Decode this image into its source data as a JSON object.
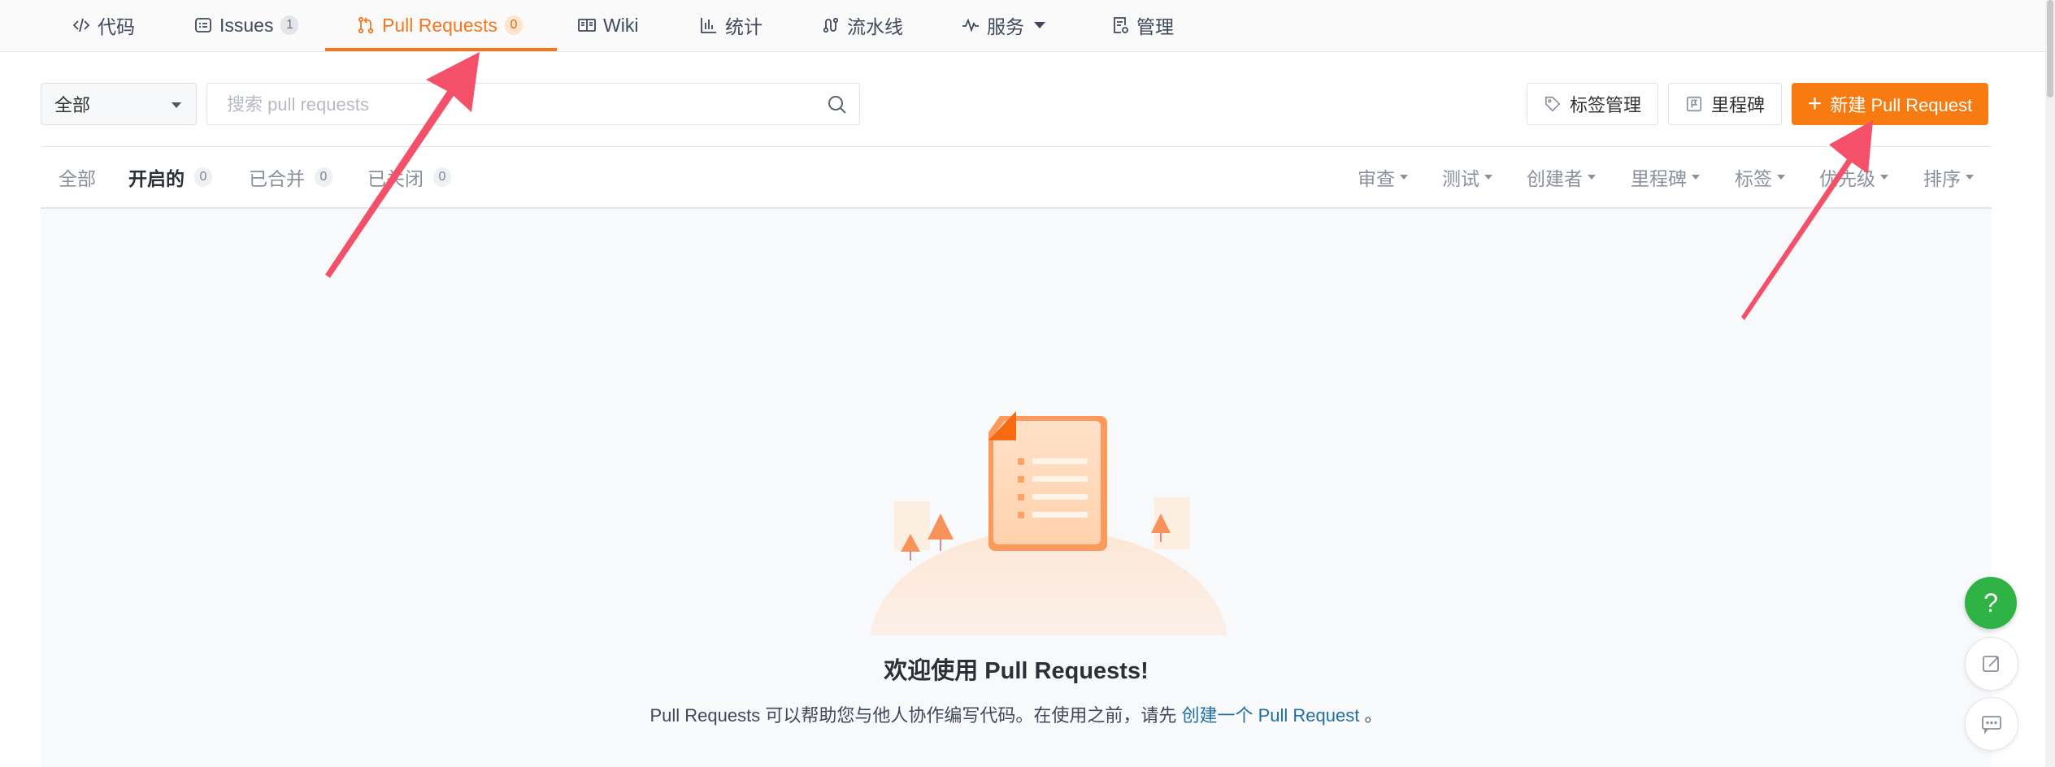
{
  "nav": {
    "tabs": [
      {
        "label": "代码",
        "icon": "code-icon"
      },
      {
        "label": "Issues",
        "badge": "1",
        "icon": "issues-icon"
      },
      {
        "label": "Pull Requests",
        "badge": "0",
        "icon": "pull-request-icon",
        "active": true
      },
      {
        "label": "Wiki",
        "icon": "book-icon"
      },
      {
        "label": "统计",
        "icon": "chart-icon"
      },
      {
        "label": "流水线",
        "icon": "pipeline-icon"
      },
      {
        "label": "服务",
        "icon": "pulse-icon",
        "dropdown": true
      },
      {
        "label": "管理",
        "icon": "settings-doc-icon"
      }
    ]
  },
  "toolbar": {
    "scope_select": "全部",
    "search_placeholder": "搜索 pull requests",
    "labels_button": "标签管理",
    "milestones_button": "里程碑",
    "new_pr_button": "新建 Pull Request"
  },
  "filters": {
    "states": [
      {
        "label": "全部"
      },
      {
        "label": "开启的",
        "count": "0",
        "active": true
      },
      {
        "label": "已合并",
        "count": "0"
      },
      {
        "label": "已关闭",
        "count": "0"
      }
    ],
    "dropdowns": [
      "审查",
      "测试",
      "创建者",
      "里程碑",
      "标签",
      "优先级",
      "排序"
    ]
  },
  "empty_state": {
    "title": "欢迎使用 Pull Requests!",
    "desc_before": "Pull Requests 可以帮助您与他人协作编写代码。在使用之前，请先",
    "desc_link": "创建一个 Pull Request",
    "desc_after": "。"
  },
  "floating": {
    "help": "?"
  },
  "colors": {
    "accent": "#f77b10",
    "help_green": "#2fb344",
    "arrow": "#f4506a"
  }
}
